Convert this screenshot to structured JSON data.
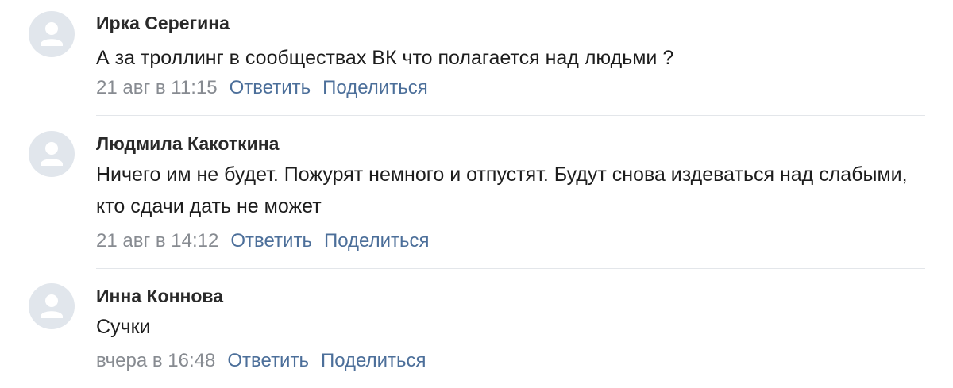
{
  "comments": [
    {
      "author": "Ирка Серегина",
      "text": "А за троллинг в сообществах ВК что полагается над людьми ?",
      "date": "21 авг в 11:15",
      "reply_label": "Ответить",
      "share_label": "Поделиться"
    },
    {
      "author": "Людмила Какоткина",
      "text": "Ничего им не будет. Пожурят немного и отпустят. Будут снова издеваться над слабыми, кто сдачи дать не может",
      "date": "21 авг в 14:12",
      "reply_label": "Ответить",
      "share_label": "Поделиться"
    },
    {
      "author": "Инна Коннова",
      "text": "Сучки",
      "date": "вчера в 16:48",
      "reply_label": "Ответить",
      "share_label": "Поделиться"
    }
  ],
  "colors": {
    "link": "#4c6f9a",
    "date": "#878b91",
    "avatar_bg": "#e1e6ec",
    "avatar_fg": "#ffffff"
  },
  "icons": {
    "avatar": "user-placeholder-icon"
  }
}
